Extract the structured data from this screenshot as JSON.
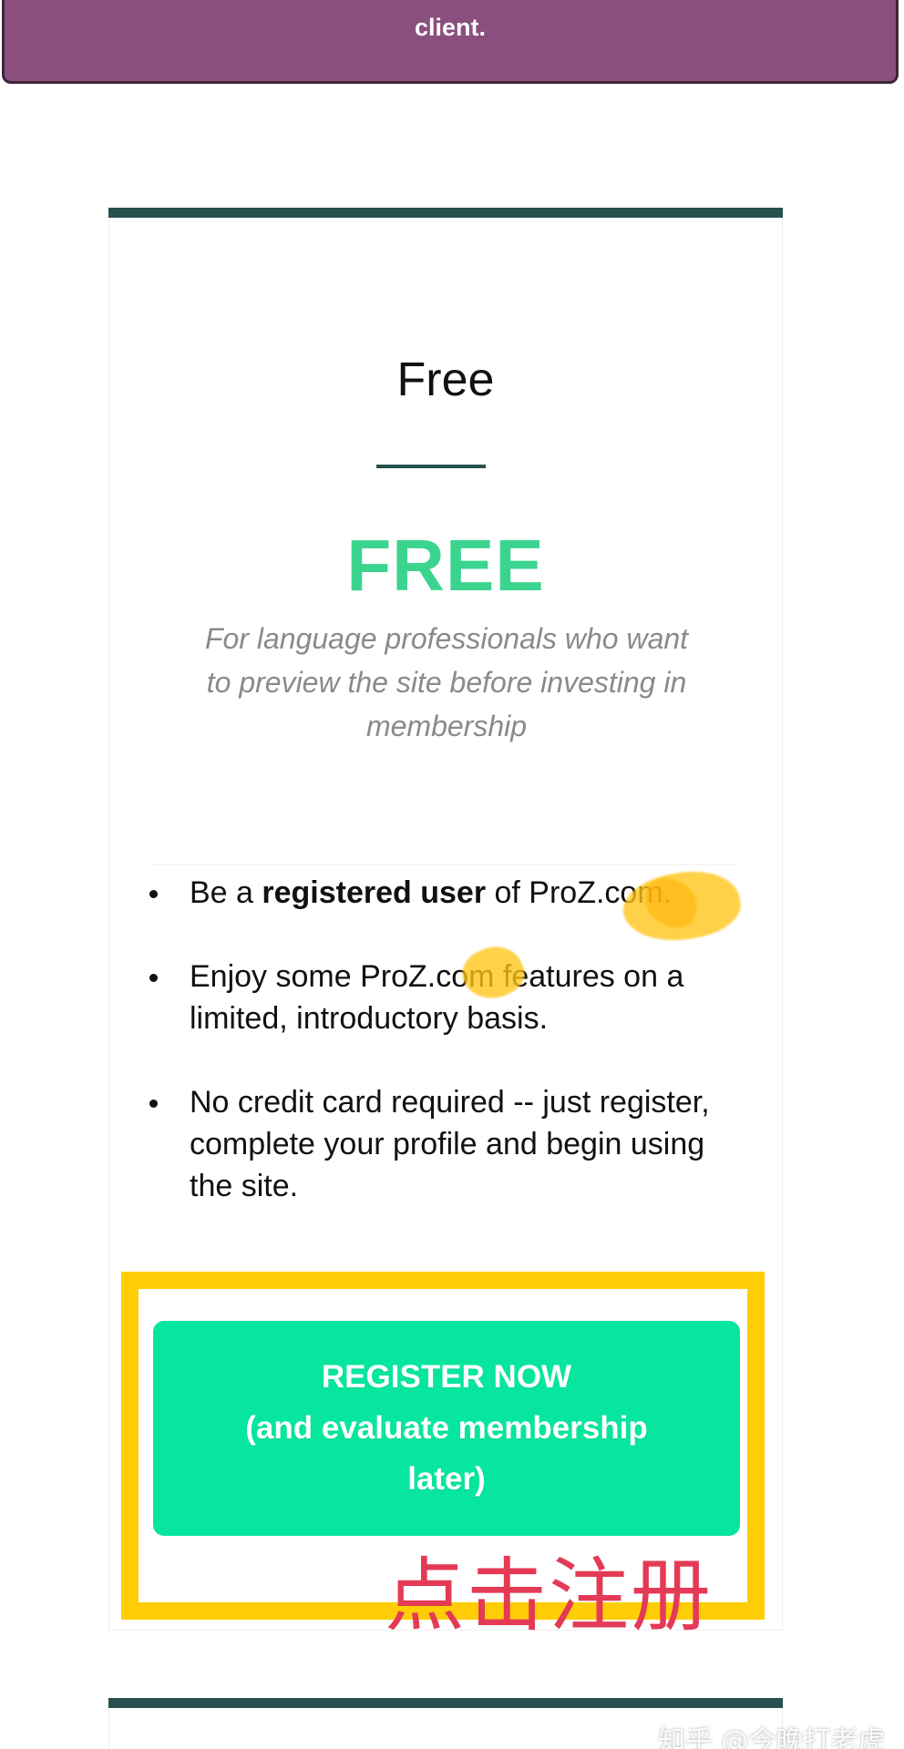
{
  "banner": {
    "text": "client."
  },
  "plan": {
    "name": "Free",
    "price": "FREE",
    "description": "For language professionals who want to preview the site before investing in membership",
    "features": [
      {
        "prefix": "Be a ",
        "strong": "registered user",
        "suffix": " of ProZ.com."
      },
      {
        "text": "Enjoy some ProZ.com features on a limited, introductory basis."
      },
      {
        "text": "No credit card required -- just register, complete your profile and begin using the site."
      }
    ],
    "register_button": {
      "line1": "REGISTER NOW",
      "line2": "(and evaluate membership",
      "line3": "later)"
    }
  },
  "annotation": {
    "text": "点击注册",
    "frame_color": "#ffcd05",
    "text_color": "#e43a55"
  },
  "watermark": {
    "text": "知乎 @今晚打老虎"
  },
  "colors": {
    "banner": "#8a4f7d",
    "card_accent": "#27514f",
    "price_green": "#3bd48f",
    "button_green": "#07e69e"
  }
}
